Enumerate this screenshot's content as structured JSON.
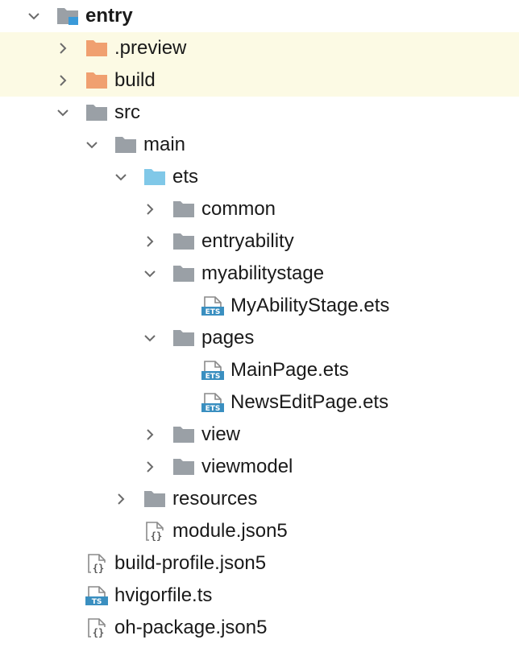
{
  "colors": {
    "folder_gray": "#9aa0a6",
    "folder_orange": "#f0a070",
    "folder_blue": "#80c8e8",
    "module_badge": "#3a9ad9",
    "excluded_row_bg": "#fcfae4",
    "ets_badge": "#3a8fc0",
    "ts_badge": "#3a8fc0"
  },
  "project_tree": {
    "items": [
      {
        "label": "entry",
        "icon": "module-folder-icon",
        "chevron": "expanded",
        "depth": 0,
        "bold": true
      },
      {
        "label": ".preview",
        "icon": "excluded-folder-icon",
        "chevron": "collapsed",
        "depth": 1,
        "excluded": true
      },
      {
        "label": "build",
        "icon": "excluded-folder-icon",
        "chevron": "collapsed",
        "depth": 1,
        "excluded": true
      },
      {
        "label": "src",
        "icon": "folder-icon",
        "chevron": "expanded",
        "depth": 1
      },
      {
        "label": "main",
        "icon": "folder-icon",
        "chevron": "expanded",
        "depth": 2
      },
      {
        "label": "ets",
        "icon": "source-folder-icon",
        "chevron": "expanded",
        "depth": 3
      },
      {
        "label": "common",
        "icon": "folder-icon",
        "chevron": "collapsed",
        "depth": 4
      },
      {
        "label": "entryability",
        "icon": "folder-icon",
        "chevron": "collapsed",
        "depth": 4
      },
      {
        "label": "myabilitystage",
        "icon": "folder-icon",
        "chevron": "expanded",
        "depth": 4
      },
      {
        "label": "MyAbilityStage.ets",
        "icon": "ets-file-icon",
        "chevron": "none",
        "depth": 5
      },
      {
        "label": "pages",
        "icon": "folder-icon",
        "chevron": "expanded",
        "depth": 4
      },
      {
        "label": "MainPage.ets",
        "icon": "ets-file-icon",
        "chevron": "none",
        "depth": 5
      },
      {
        "label": "NewsEditPage.ets",
        "icon": "ets-file-icon",
        "chevron": "none",
        "depth": 5
      },
      {
        "label": "view",
        "icon": "folder-icon",
        "chevron": "collapsed",
        "depth": 4
      },
      {
        "label": "viewmodel",
        "icon": "folder-icon",
        "chevron": "collapsed",
        "depth": 4
      },
      {
        "label": "resources",
        "icon": "folder-icon",
        "chevron": "collapsed",
        "depth": 3
      },
      {
        "label": "module.json5",
        "icon": "json-file-icon",
        "chevron": "none",
        "depth": 3
      },
      {
        "label": "build-profile.json5",
        "icon": "json-file-icon",
        "chevron": "none",
        "depth": 1
      },
      {
        "label": "hvigorfile.ts",
        "icon": "ts-file-icon",
        "chevron": "none",
        "depth": 1
      },
      {
        "label": "oh-package.json5",
        "icon": "json-file-icon",
        "chevron": "none",
        "depth": 1
      }
    ]
  }
}
